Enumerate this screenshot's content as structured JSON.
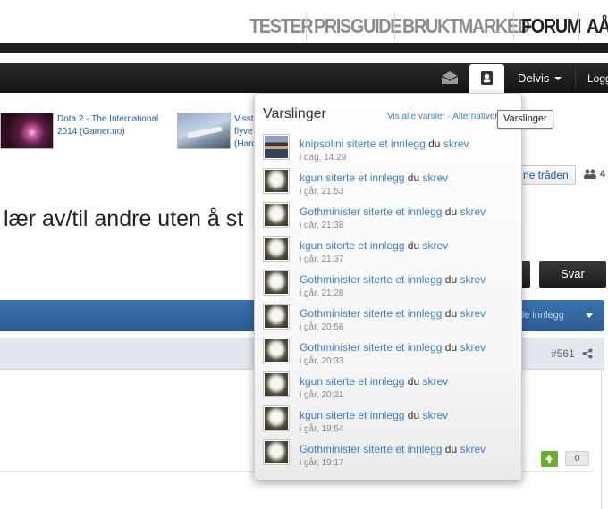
{
  "top_nav": {
    "items": [
      "TESTER",
      "PRISGUIDE",
      "BRUKTMARKED",
      "FORUM",
      "AÅ"
    ]
  },
  "user_bar": {
    "username": "Delvis",
    "logout": "Logg"
  },
  "articles": [
    {
      "line1": "Dota 2 - The International",
      "line2": "2014 (Gamer.no)"
    },
    {
      "line1": "Visst",
      "line2": "flyve",
      "line3": "(Hard"
    }
  ],
  "follow": {
    "label": "ne tråden",
    "count": "4"
  },
  "thread": {
    "title": "lær av/til andre uten å st"
  },
  "buttons": {
    "reply": "Svar"
  },
  "bluebar": {
    "label": "e alle innlegg"
  },
  "post": {
    "number": "#561",
    "votes": "0"
  },
  "notifications": {
    "title": "Varslinger",
    "links": "Vis alle varsler · Alternativer",
    "tooltip": "Varslinger",
    "items": [
      {
        "user": "knipsolini",
        "action": "siterte et innlegg",
        "du": "du",
        "skrev": "skrev",
        "time": "i dag, 14:29",
        "avatar": "person"
      },
      {
        "user": "kgun",
        "action": "siterte et innlegg",
        "du": "du",
        "skrev": "skrev",
        "time": "i går, 21:53",
        "avatar": "owl"
      },
      {
        "user": "Gothminister",
        "action": "siterte et innlegg",
        "du": "du",
        "skrev": "skrev",
        "time": "i går, 21:38",
        "avatar": "owl"
      },
      {
        "user": "kgun",
        "action": "siterte et innlegg",
        "du": "du",
        "skrev": "skrev",
        "time": "i går, 21:37",
        "avatar": "owl"
      },
      {
        "user": "Gothminister",
        "action": "siterte et innlegg",
        "du": "du",
        "skrev": "skrev",
        "time": "i går, 21:28",
        "avatar": "owl"
      },
      {
        "user": "Gothminister",
        "action": "siterte et innlegg",
        "du": "du",
        "skrev": "skrev",
        "time": "i går, 20:56",
        "avatar": "owl"
      },
      {
        "user": "Gothminister",
        "action": "siterte et innlegg",
        "du": "du",
        "skrev": "skrev",
        "time": "i går, 20:33",
        "avatar": "owl"
      },
      {
        "user": "kgun",
        "action": "siterte et innlegg",
        "du": "du",
        "skrev": "skrev",
        "time": "i går, 20:21",
        "avatar": "owl"
      },
      {
        "user": "kgun",
        "action": "siterte et innlegg",
        "du": "du",
        "skrev": "skrev",
        "time": "i går, 19:54",
        "avatar": "owl"
      },
      {
        "user": "Gothminister",
        "action": "siterte et innlegg",
        "du": "du",
        "skrev": "skrev",
        "time": "i går, 19:17",
        "avatar": "owl"
      }
    ]
  },
  "colors": {
    "link": "#3d7ec5",
    "bluebar": "#2f6199",
    "vote": "#6ab02f"
  }
}
